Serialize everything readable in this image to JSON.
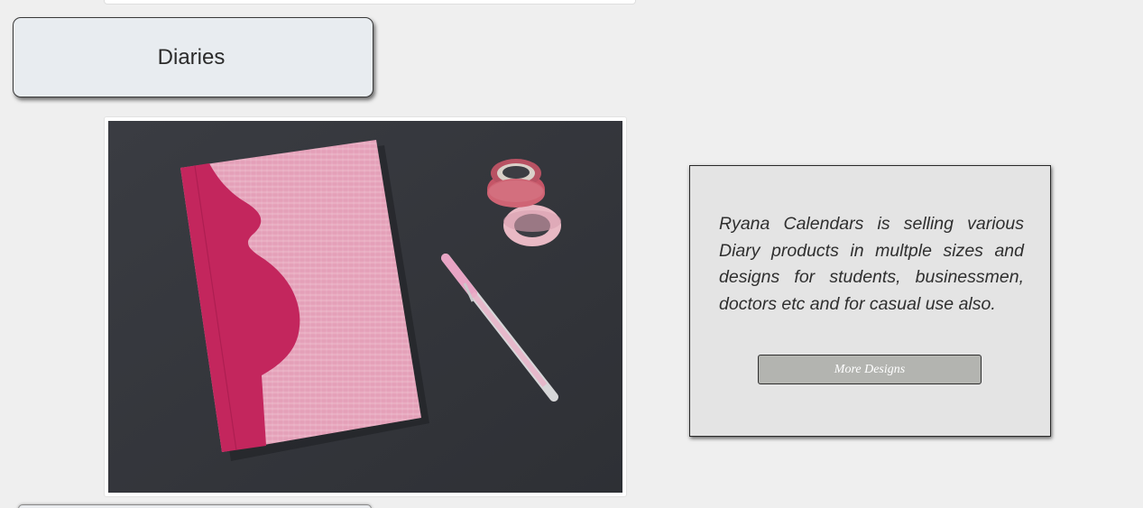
{
  "category": {
    "title": "Diaries"
  },
  "product_image": {
    "alt": "Pink fabric-covered diary with washi tape rolls and a pink gel pen on a dark surface",
    "colors": {
      "background": "#34363c",
      "cover_light": "#e7a3bc",
      "cover_dark": "#c4275f",
      "tape_red": "#c75a6c",
      "pen": "#e8a4c4"
    }
  },
  "info": {
    "description": "Ryana Calendars is selling various Diary products in multple sizes and designs for students, businessmen, doctors etc and for casual use also.",
    "more_button_label": "More Designs"
  }
}
